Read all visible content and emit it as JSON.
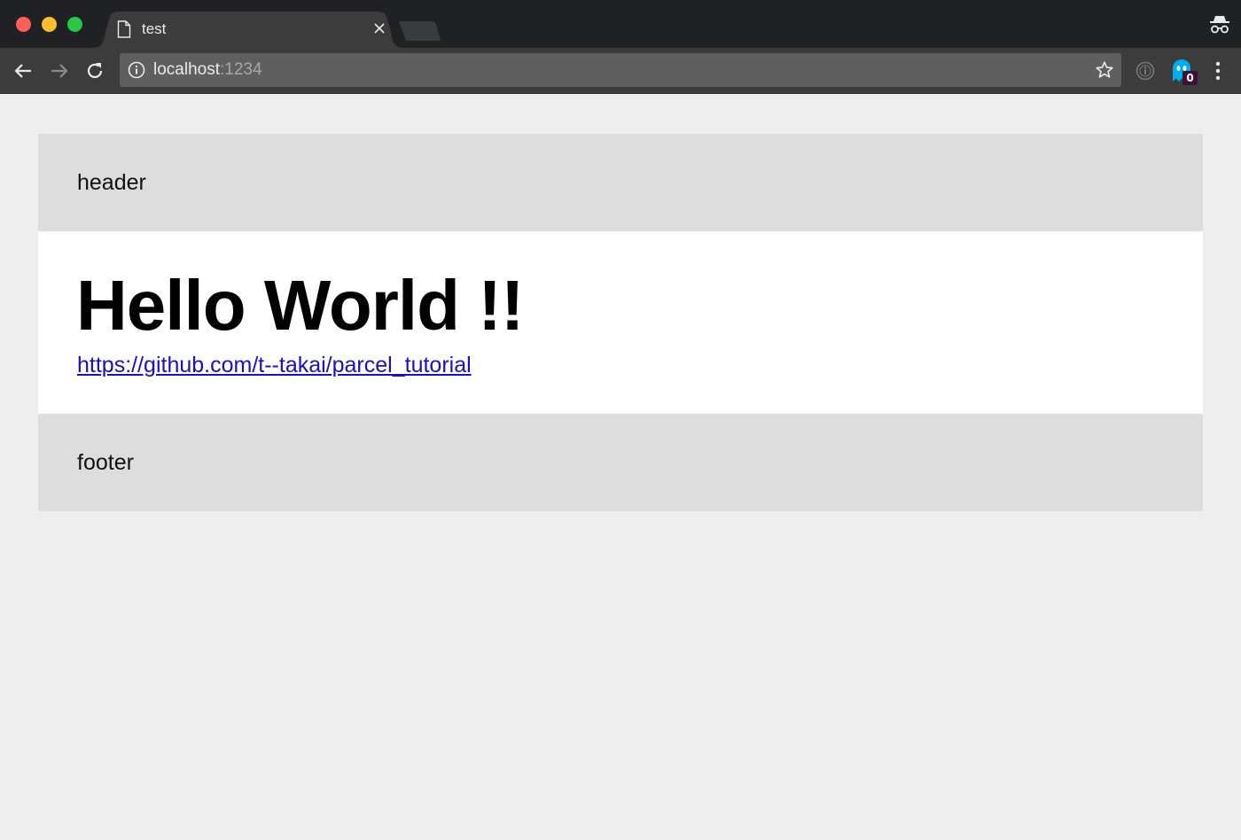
{
  "window": {
    "traffic_lights": {
      "close": "#fe5f57",
      "minimize": "#febc2e",
      "maximize": "#28c840"
    }
  },
  "tab": {
    "title": "test",
    "icon": "file-icon",
    "close_icon": "close-icon"
  },
  "toolbar": {
    "back_icon": "arrow-left-icon",
    "forward_icon": "arrow-right-icon",
    "reload_icon": "reload-icon",
    "address": {
      "host": "localhost",
      "port": ":1234",
      "security_icon": "info-icon",
      "bookmark_icon": "star-icon"
    },
    "extensions": [
      {
        "icon": "info-circle-icon"
      },
      {
        "icon": "ghost-icon",
        "badge": "0"
      }
    ],
    "menu_icon": "vertical-dots-icon",
    "incognito_icon": "incognito-icon"
  },
  "page": {
    "header_text": "header",
    "heading": "Hello World !!",
    "link_text": "https://github.com/t--takai/parcel_tutorial",
    "footer_text": "footer"
  }
}
